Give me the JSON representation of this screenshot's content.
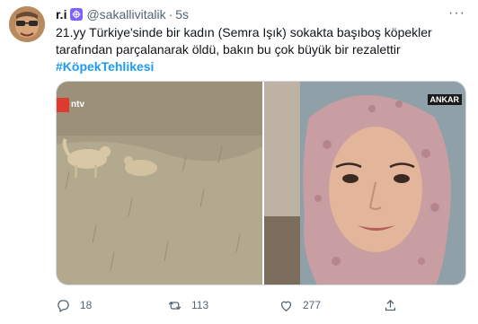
{
  "tweet": {
    "display_name": "r.i",
    "handle": "@sakallivitalik",
    "separator": "·",
    "time": "5s",
    "more": "···",
    "text_line1": "21.yy Türkiye'sinde bir kadın (Semra Işık) sokakta başıboş köpekler",
    "text_line2": "tarafından parçalanarak öldü, bakın bu çok büyük bir rezalettir",
    "hashtag": "#KöpekTehlikesi",
    "media_watermark_left": "ntv",
    "media_watermark_right": "ANKAR",
    "replies": "18",
    "retweets": "113",
    "likes": "277"
  },
  "colors": {
    "accent": "#1d9bf0",
    "secondary_text": "#536471",
    "border": "#cfd9de",
    "badge": "#7b61ff"
  },
  "icons": [
    "avatar",
    "verified-badge-icon",
    "more-icon",
    "reply-icon",
    "retweet-icon",
    "like-icon",
    "share-icon"
  ]
}
